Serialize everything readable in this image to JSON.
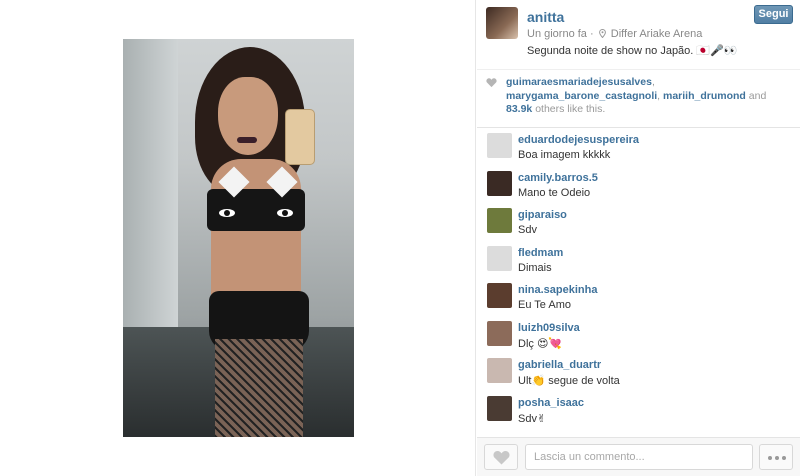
{
  "post": {
    "username": "anitta",
    "time": "Un giorno fa",
    "location": "Differ Ariake Arena",
    "caption": "Segunda noite de show no Japão. 🇯🇵🎤👀",
    "follow_label": "Segui"
  },
  "likes": {
    "users": [
      "guimaraesmariadejesusalves",
      "marygama_barone_castagnoli",
      "mariih_drumond"
    ],
    "count": "83.9k",
    "and_text": "and",
    "suffix": "others like this."
  },
  "comments": [
    {
      "user": "eduardodejesuspereira",
      "text": "Boa imagem kkkkk",
      "avatar_color": "#dcdcdc"
    },
    {
      "user": "camily.barros.5",
      "text": "Mano te Odeio",
      "avatar_color": "#3a2a24"
    },
    {
      "user": "giparaiso",
      "text": "Sdv",
      "avatar_color": "#6e7a3c"
    },
    {
      "user": "fledmam",
      "text": "Dimais",
      "avatar_color": "#dcdcdc"
    },
    {
      "user": "nina.sapekinha",
      "text": "Eu Te Amo",
      "avatar_color": "#5b3d2e"
    },
    {
      "user": "luizh09silva",
      "text": "Dlç 😍💘",
      "avatar_color": "#8c6b5a"
    },
    {
      "user": "gabriella_duartr",
      "text": "Ult👏 segue de volta",
      "avatar_color": "#c9b8b0"
    },
    {
      "user": "posha_isaac",
      "text": "Sdv✌",
      "avatar_color": "#4a3b33"
    }
  ],
  "footer": {
    "comment_placeholder": "Lascia un commento..."
  },
  "colors": {
    "link": "#3f729b",
    "follow_button": "#517fa4"
  },
  "icons": [
    "location-pin-icon",
    "heart-icon",
    "like-heart-icon",
    "more-options-icon"
  ]
}
